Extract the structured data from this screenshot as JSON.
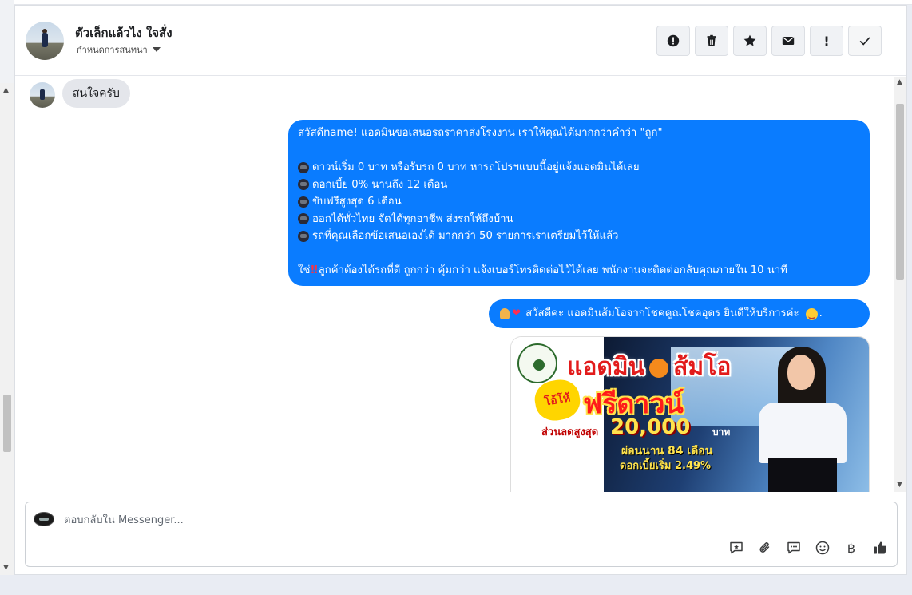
{
  "header": {
    "user_name": "ตัวเล็กแล้วไง ใจสั่ง",
    "assign_label": "กำหนดการสนทนา"
  },
  "actions": [
    {
      "icon": "alert-circle-icon"
    },
    {
      "icon": "trash-icon"
    },
    {
      "icon": "star-icon"
    },
    {
      "icon": "envelope-icon"
    },
    {
      "icon": "exclamation-icon",
      "label": "!"
    },
    {
      "icon": "check-icon"
    }
  ],
  "messages": {
    "incoming_text": "สนใจครับ",
    "offer": {
      "greeting": "สวัสดีname! แอดมินขอเสนอรถราคาส่งโรงงาน เราให้คุณได้มากกว่าคำว่า \"ถูก\"",
      "bullets": [
        "ดาวน์เริ่ม 0 บาท หรือรับรถ 0 บาท หารถโปรฯแบบนี้อยู่แจ้งแอดมินได้เลย",
        "ดอกเบี้ย 0% นานถึง 12 เดือน",
        "ขับฟรีสูงสุด 6 เดือน",
        "ออกได้ทั่วไทย จัดได้ทุกอาชีพ ส่งรถให้ถึงบ้าน",
        "รถที่คุณเลือกข้อเสนอเองได้ มากกว่า 50 รายการเราเตรียมไว้ให้แล้ว"
      ],
      "closing_prefix": "ใช่",
      "closing_mark": "‼",
      "closing_text": "ลูกค้าต้องได้รถที่ดี ถูกกว่า คุ้มกว่า แจ้งเบอร์โทรติดต่อไว้ได้เลย พนักงานจะติดต่อกลับคุณภายใน 10 นาที"
    },
    "welcome": {
      "heart": "❤",
      "text": "สวัสดีค่ะ แอดมินส้มโอจากโชคคูณโชคอุดร ยินดีให้บริการค่ะ",
      "suffix": "."
    },
    "promo_image": {
      "title_left": "แอดมิน",
      "title_right": "ส้มโอ",
      "burst": "โอ้โห้",
      "free_down": "ฟรีดาวน์",
      "discount_label": "ส่วนลดสูงสุด",
      "amount": "20,000",
      "amount_unit": "บาท",
      "months": "ผ่อนนาน 84 เดือน",
      "rate": "ดอกเบี้ยเริ่ม 2.49%"
    }
  },
  "composer": {
    "placeholder": "ตอบกลับใน Messenger..."
  },
  "tools": [
    {
      "icon": "saved-reply-icon"
    },
    {
      "icon": "attachment-icon"
    },
    {
      "icon": "chat-bubble-icon"
    },
    {
      "icon": "emoji-icon"
    },
    {
      "icon": "baht-icon",
      "label": "฿"
    },
    {
      "icon": "like-icon"
    }
  ],
  "colors": {
    "accent": "#0a7cff",
    "incoming_bubble": "#e4e6eb"
  }
}
